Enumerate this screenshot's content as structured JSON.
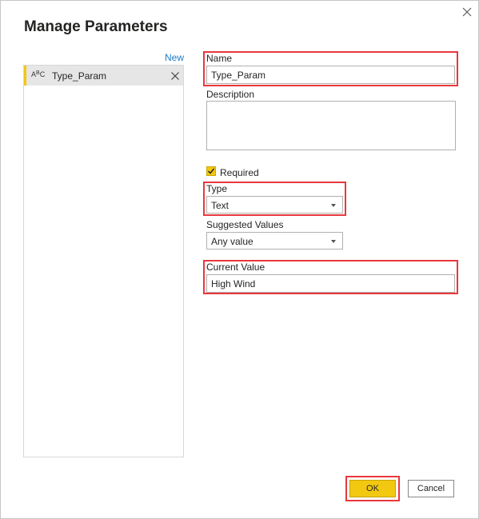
{
  "dialog": {
    "title": "Manage Parameters",
    "new_link": "New",
    "close_icon": "close-icon"
  },
  "parameters": [
    {
      "type_icon": "ABC",
      "name": "Type_Param",
      "remove_icon": "close-icon"
    }
  ],
  "form": {
    "name_label": "Name",
    "name_value": "Type_Param",
    "description_label": "Description",
    "description_value": "",
    "required_label": "Required",
    "required_checked": true,
    "type_label": "Type",
    "type_value": "Text",
    "suggested_label": "Suggested Values",
    "suggested_value": "Any value",
    "current_label": "Current Value",
    "current_value": "High Wind"
  },
  "buttons": {
    "ok": "OK",
    "cancel": "Cancel"
  },
  "colors": {
    "accent": "#f2c811",
    "highlight": "#e8383d",
    "link": "#1f7ac6"
  }
}
